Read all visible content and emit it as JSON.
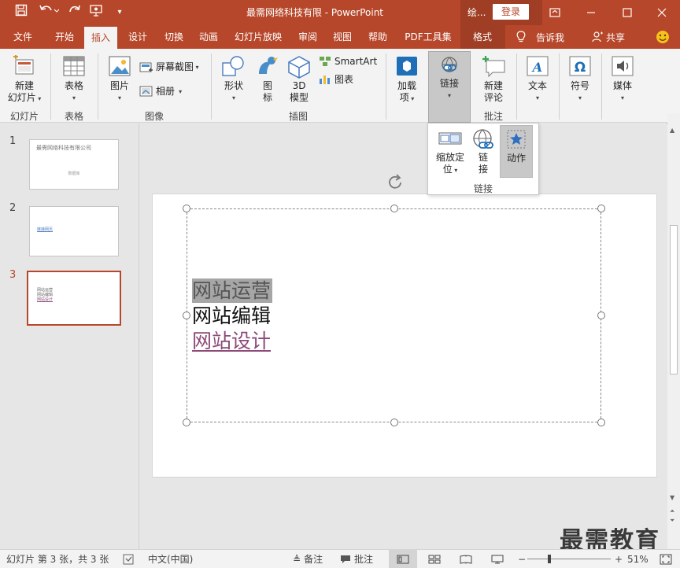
{
  "window": {
    "title": "最需网络科技有限  -  PowerPoint",
    "context_tab_top": "绘...",
    "login": "登录"
  },
  "tabs": [
    "文件",
    "开始",
    "插入",
    "设计",
    "切换",
    "动画",
    "幻灯片放映",
    "审阅",
    "视图",
    "帮助",
    "PDF工具集",
    "格式"
  ],
  "tell_me": "告诉我",
  "share": "共享",
  "ribbon": {
    "new_slide": [
      "新建",
      "幻灯片"
    ],
    "group_slides": "幻灯片",
    "table": "表格",
    "group_table": "表格",
    "picture": "图片",
    "screenshot": "屏幕截图",
    "album": "相册",
    "group_images": "图像",
    "shapes": "形状",
    "icons": [
      "图",
      "标"
    ],
    "model3d": [
      "3D",
      "模型"
    ],
    "smartart": "SmartArt",
    "chart": "图表",
    "group_illustrations": "插图",
    "addins": [
      "加载",
      "项"
    ],
    "link": "链接",
    "new_comment": [
      "新建",
      "评论"
    ],
    "group_comments": "批注",
    "text": "文本",
    "symbol": "符号",
    "media": "媒体"
  },
  "dropdown": {
    "zoom": [
      "缩放定",
      "位"
    ],
    "link": [
      "链",
      "接"
    ],
    "action": "动作",
    "group_label": "链接"
  },
  "thumbnails": [
    {
      "num": "1",
      "title": "最需网络科技有限公司",
      "sub": "数据库"
    },
    {
      "num": "2",
      "line": "链接网页"
    },
    {
      "num": "3",
      "lines": [
        "网站运营",
        "网站编辑",
        "网站设计"
      ]
    }
  ],
  "slide": {
    "lines": [
      "网站运营",
      "网站编辑",
      "网站设计"
    ]
  },
  "status": {
    "slide_info": "幻灯片 第 3 张，共 3 张",
    "language": "中文(中国)",
    "notes": "备注",
    "comments": "批注",
    "zoom": "51%"
  },
  "watermark": "最需教育",
  "colors": {
    "accent": "#b7472a",
    "ribbon_bg": "#f3f3f3",
    "visited_link": "#8b4a78"
  }
}
